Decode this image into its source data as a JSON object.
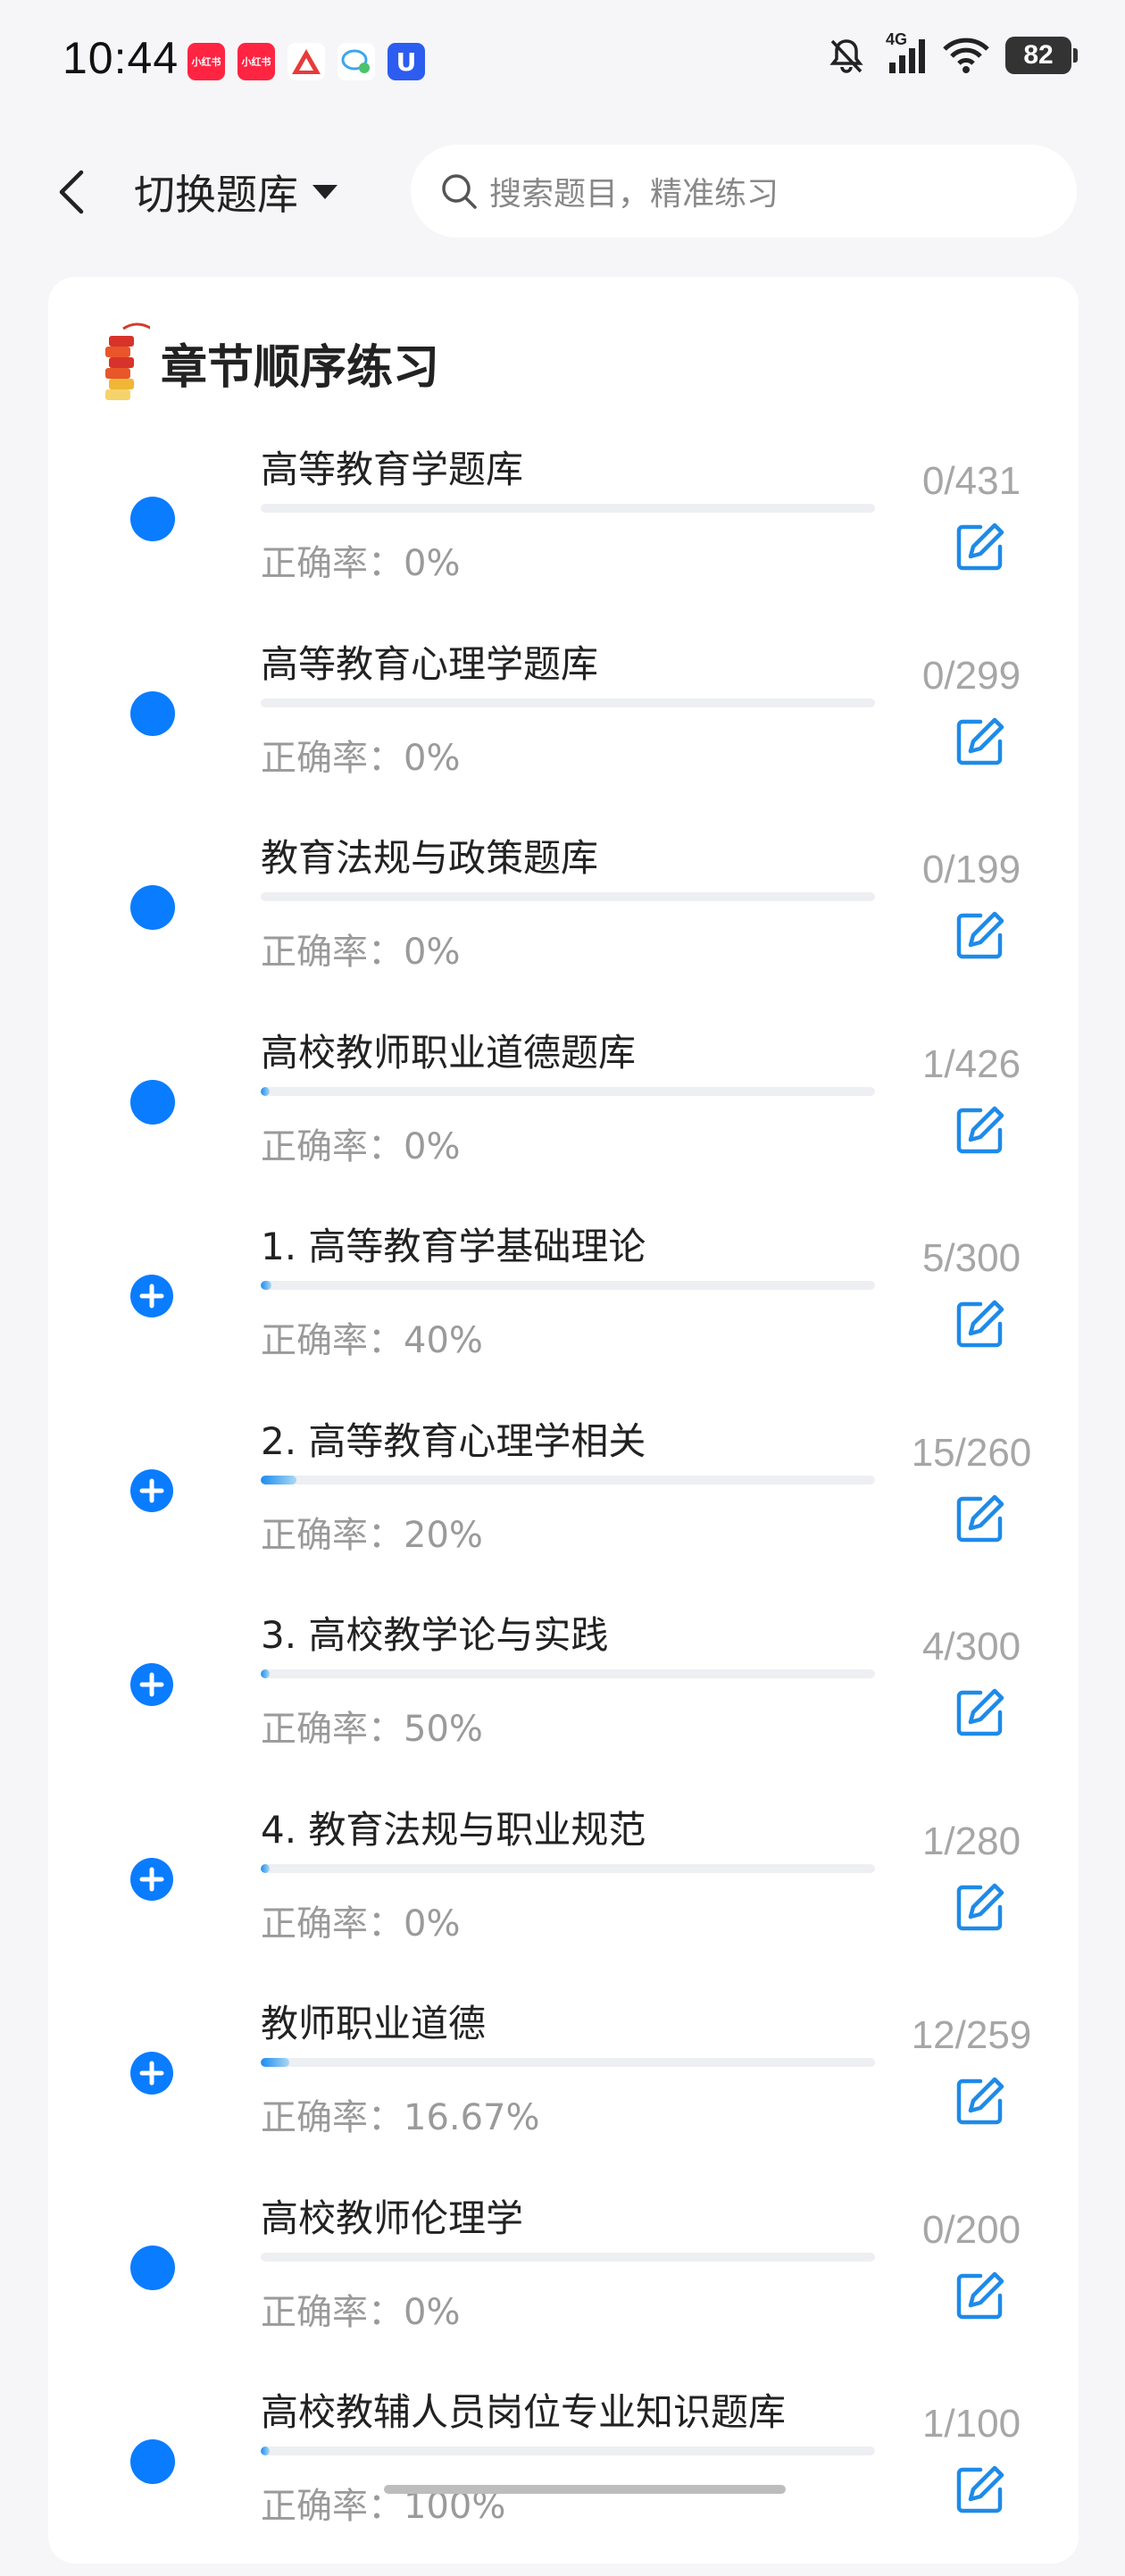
{
  "status": {
    "time": "10:44",
    "network": "4G",
    "battery": "82",
    "apps": [
      {
        "name": "xiaohongshu-icon",
        "label": "小红书",
        "color": "#ff2442"
      },
      {
        "name": "xiaohongshu-icon",
        "label": "小红书",
        "color": "#ff2442"
      },
      {
        "name": "triangle-app-icon",
        "label": "",
        "color": "#ffffff"
      },
      {
        "name": "chat-app-icon",
        "label": "",
        "color": "#ffffff"
      },
      {
        "name": "shield-app-icon",
        "label": "U",
        "color": "#2d5cf0"
      }
    ]
  },
  "nav": {
    "switch_label": "切换题库",
    "search_placeholder": "搜索题目，精准练习"
  },
  "section": {
    "title": "章节顺序练习"
  },
  "items": [
    {
      "title": "高等教育学题库",
      "accuracy": "正确率：0%",
      "count": "0/431",
      "progress": 0.0,
      "expandable": false
    },
    {
      "title": "高等教育心理学题库",
      "accuracy": "正确率：0%",
      "count": "0/299",
      "progress": 0.0,
      "expandable": false
    },
    {
      "title": "教育法规与政策题库",
      "accuracy": "正确率：0%",
      "count": "0/199",
      "progress": 0.0,
      "expandable": false
    },
    {
      "title": "高校教师职业道德题库",
      "accuracy": "正确率：0%",
      "count": "1/426",
      "progress": 0.002,
      "expandable": false
    },
    {
      "title": "1. 高等教育学基础理论",
      "accuracy": "正确率：40%",
      "count": "5/300",
      "progress": 0.017,
      "expandable": true
    },
    {
      "title": "2. 高等教育心理学相关",
      "accuracy": "正确率：20%",
      "count": "15/260",
      "progress": 0.058,
      "expandable": true
    },
    {
      "title": "3. 高校教学论与实践",
      "accuracy": "正确率：50%",
      "count": "4/300",
      "progress": 0.013,
      "expandable": true
    },
    {
      "title": "4. 教育法规与职业规范",
      "accuracy": "正确率：0%",
      "count": "1/280",
      "progress": 0.004,
      "expandable": true
    },
    {
      "title": "教师职业道德",
      "accuracy": "正确率：16.67%",
      "count": "12/259",
      "progress": 0.046,
      "expandable": true
    },
    {
      "title": "高校教师伦理学",
      "accuracy": "正确率：0%",
      "count": "0/200",
      "progress": 0.0,
      "expandable": false
    },
    {
      "title": "高校教辅人员岗位专业知识题库",
      "accuracy": "正确率：100%",
      "count": "1/100",
      "progress": 0.01,
      "expandable": false
    }
  ]
}
